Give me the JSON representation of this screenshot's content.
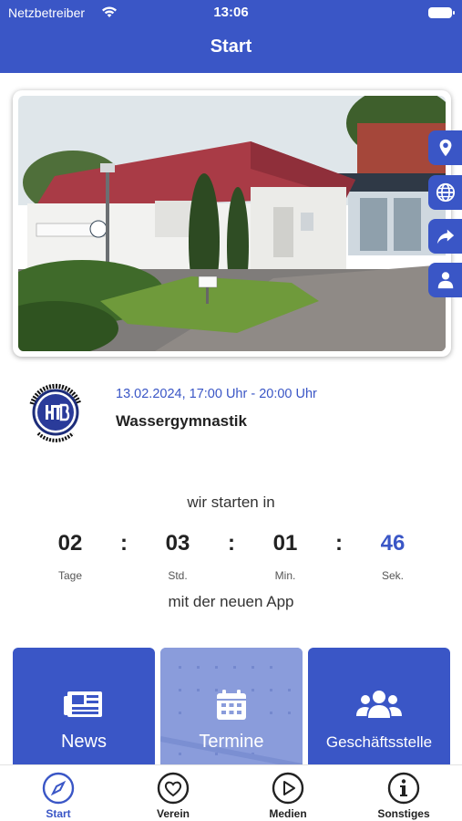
{
  "status_bar": {
    "carrier": "Netzbetreiber",
    "time": "13:06"
  },
  "header": {
    "title": "Start"
  },
  "side_buttons": [
    "location-pin-icon",
    "globe-icon",
    "share-icon",
    "person-icon"
  ],
  "event": {
    "date": "13.02.2024, 17:00 Uhr - 20:00 Uhr",
    "title": "Wassergymnastik"
  },
  "countdown": {
    "intro": "wir starten in",
    "outro": "mit der neuen App",
    "separator": ":",
    "units": [
      {
        "value": "02",
        "label": "Tage"
      },
      {
        "value": "03",
        "label": "Std."
      },
      {
        "value": "01",
        "label": "Min."
      },
      {
        "value": "46",
        "label": "Sek."
      }
    ]
  },
  "tiles": [
    {
      "label": "News",
      "icon": "newspaper-icon"
    },
    {
      "label": "Termine",
      "icon": "calendar-icon"
    },
    {
      "label": "Geschäftsstelle",
      "icon": "users-icon"
    }
  ],
  "nav": {
    "items": [
      {
        "label": "Start",
        "icon": "compass-icon",
        "active": true
      },
      {
        "label": "Verein",
        "icon": "heart-icon",
        "active": false
      },
      {
        "label": "Medien",
        "icon": "play-icon",
        "active": false
      },
      {
        "label": "Sonstiges",
        "icon": "info-icon",
        "active": false
      }
    ]
  },
  "colors": {
    "primary": "#3a56c6",
    "accent_seconds": "#3a56c6",
    "text": "#222222"
  }
}
